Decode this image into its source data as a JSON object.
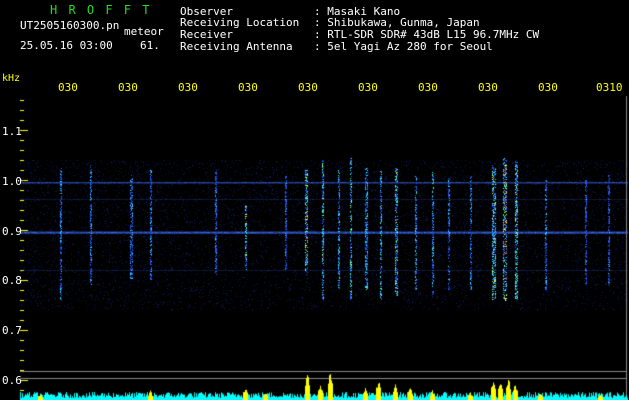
{
  "header": {
    "app_title": "H R O F F T",
    "filename": "UT2505160300.pn",
    "mode": "meteor",
    "datetime": "25.05.16 03:00",
    "count": "61.",
    "rows": [
      {
        "label": "Observer",
        "value": ": Masaki Kano"
      },
      {
        "label": "Receiving Location",
        "value": ": Shibukawa, Gunma, Japan"
      },
      {
        "label": "Receiver",
        "value": ": RTL-SDR SDR# 43dB L15 96.7MHz CW"
      },
      {
        "label": "Receiving Antenna",
        "value": ": 5el Yagi Az 280 for Seoul"
      }
    ]
  },
  "axis": {
    "y_unit": "kHz",
    "y_ticks": [
      "1.1",
      "1.0",
      "0.9",
      "0.8",
      "0.7",
      "0.6"
    ],
    "x_ticks": [
      "030",
      "030",
      "030",
      "030",
      "030",
      "030",
      "030",
      "030",
      "030",
      "0310"
    ]
  },
  "colors": {
    "title_green": "#22dd22",
    "label_white": "#ffffff",
    "tick_yellow": "#ffff00",
    "carrier_blue": "#3366ff",
    "activity_yellow": "#ffff00",
    "activity_cyan": "#00ffff"
  }
}
